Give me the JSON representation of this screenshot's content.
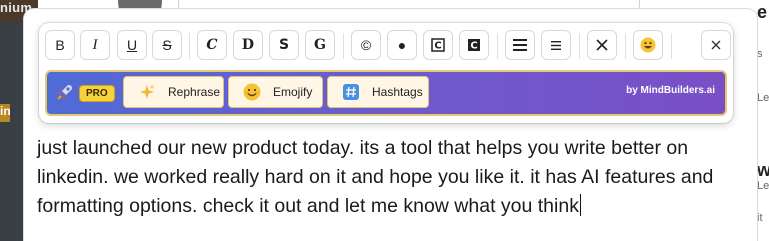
{
  "background": {
    "left_strip_label": "nium",
    "left_strip_tag": "in",
    "right_fragments": [
      "e",
      "s",
      "Le",
      "w",
      "Le",
      "it"
    ]
  },
  "toolbar": {
    "buttons": [
      {
        "name": "bold-button",
        "glyph": "B"
      },
      {
        "name": "italic-button",
        "glyph": "I"
      },
      {
        "name": "underline-button",
        "glyph": "U"
      },
      {
        "name": "strikethrough-button",
        "glyph": "S"
      },
      {
        "name": "script-font-button",
        "glyph": "C"
      },
      {
        "name": "double-struck-font-button",
        "glyph": "D"
      },
      {
        "name": "sans-bold-font-button",
        "glyph": "S"
      },
      {
        "name": "gothic-font-button",
        "glyph": "G"
      },
      {
        "name": "circled-letters-button",
        "glyph": "©"
      },
      {
        "name": "filled-circle-button",
        "glyph": "●"
      },
      {
        "name": "squared-letters-button",
        "glyph": "🄲"
      },
      {
        "name": "negative-squared-letters-button",
        "glyph": "🅲"
      },
      {
        "name": "bullet-list-button",
        "glyph": "☰"
      },
      {
        "name": "numbered-list-button",
        "glyph": "≡"
      },
      {
        "name": "clear-format-button",
        "glyph": "✕"
      },
      {
        "name": "emoji-picker-button",
        "glyph": "😀"
      },
      {
        "name": "close-toolbar-button",
        "glyph": "✕"
      }
    ]
  },
  "ai_bar": {
    "badge": "PRO",
    "actions": [
      {
        "label": "Rephrase",
        "icon": "sparkles-icon",
        "emoji": "✨"
      },
      {
        "label": "Emojify",
        "icon": "smile-icon",
        "emoji": "😊"
      },
      {
        "label": "Hashtags",
        "icon": "hash-icon",
        "emoji": "#"
      }
    ],
    "credit": "by MindBuilders.ai",
    "colors": {
      "gradient_start": "#4f6bd6",
      "gradient_end": "#7a4fc6",
      "border": "#e6c86e",
      "badge": "#f7d23a"
    }
  },
  "editor": {
    "text": "just launched our new product today. its a tool that helps you write better on linkedin. we worked really hard on it and hope you like it. it has AI features and formatting options. check it out and let me know what you think"
  }
}
